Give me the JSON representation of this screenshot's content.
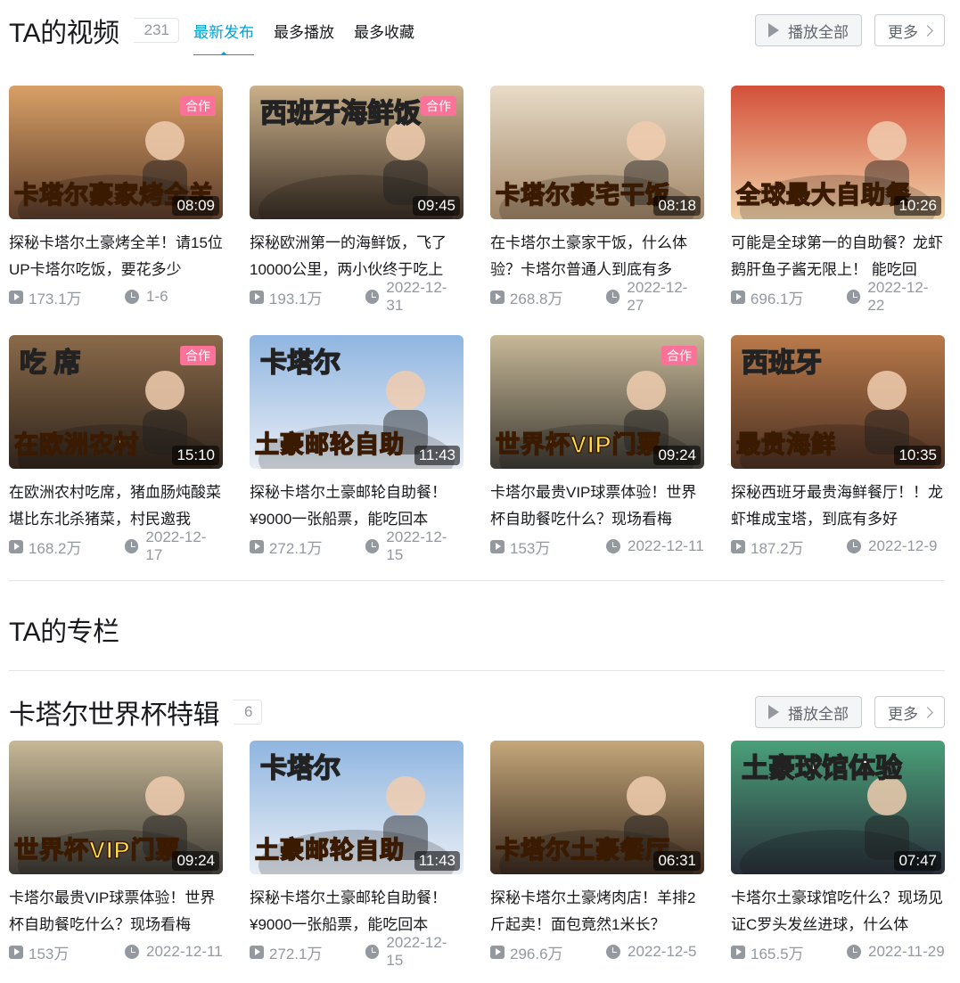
{
  "videos_section": {
    "title": "TA的视频",
    "count": "231",
    "tabs": [
      {
        "label": "最新发布",
        "active": true
      },
      {
        "label": "最多播放",
        "active": false
      },
      {
        "label": "最多收藏",
        "active": false
      }
    ],
    "play_all_label": "播放全部",
    "more_label": "更多",
    "videos": [
      {
        "overlay": "卡塔尔豪家烤全羊",
        "top": "",
        "duration": "08:09",
        "collab": "合作",
        "title": "探秘卡塔尔土豪烤全羊！请15位UP卡塔尔吃饭，要花多少",
        "views": "173.1万",
        "date": "1-6",
        "bg1": "#d9a066",
        "bg2": "#5a3b2a"
      },
      {
        "overlay": "",
        "top": "西班牙海鲜饭",
        "duration": "09:45",
        "collab": "合作",
        "title": "探秘欧洲第一的海鲜饭，飞了10000公里，两小伙终于吃上",
        "views": "193.1万",
        "date": "2022-12-31",
        "bg1": "#c9b08a",
        "bg2": "#3a2e25"
      },
      {
        "overlay": "卡塔尔豪宅干饭",
        "top": "",
        "duration": "08:18",
        "collab": "",
        "title": "在卡塔尔土豪家干饭，什么体验？卡塔尔普通人到底有多",
        "views": "268.8万",
        "date": "2022-12-27",
        "bg1": "#e8dcc8",
        "bg2": "#a08466"
      },
      {
        "overlay": "全球最大自助餐",
        "top": "",
        "duration": "10:26",
        "collab": "",
        "title": "可能是全球第一的自助餐？龙虾鹅肝鱼子酱无限上！ 能吃回",
        "views": "696.1万",
        "date": "2022-12-22",
        "bg1": "#d4503a",
        "bg2": "#f0d2a8"
      },
      {
        "overlay": "在欧洲农村",
        "top": "吃 席",
        "duration": "15:10",
        "collab": "合作",
        "title": "在欧洲农村吃席，猪血肠炖酸菜堪比东北杀猪菜，村民邀我",
        "views": "168.2万",
        "date": "2022-12-17",
        "bg1": "#8a6a4a",
        "bg2": "#2f241c"
      },
      {
        "overlay": "土豪邮轮自助",
        "top": "卡塔尔",
        "duration": "11:43",
        "collab": "",
        "title": "探秘卡塔尔土豪邮轮自助餐！¥9000一张船票，能吃回本",
        "views": "272.1万",
        "date": "2022-12-15",
        "bg1": "#8fb5e0",
        "bg2": "#e9eef5"
      },
      {
        "overlay": "世界杯VIP门票",
        "top": "",
        "duration": "09:24",
        "collab": "合作",
        "title": "卡塔尔最贵VIP球票体验！世界杯自助餐吃什么？现场看梅",
        "views": "153万",
        "date": "2022-12-11",
        "bg1": "#c7b897",
        "bg2": "#3d3a34"
      },
      {
        "overlay": "最贵海鲜",
        "top": "西班牙",
        "duration": "10:35",
        "collab": "",
        "title": "探秘西班牙最贵海鲜餐厅！！龙虾堆成宝塔，到底有多好",
        "views": "187.2万",
        "date": "2022-12-9",
        "bg1": "#b97a4a",
        "bg2": "#4a2f22"
      }
    ]
  },
  "columns_section": {
    "title": "TA的专栏"
  },
  "playlist_section": {
    "title": "卡塔尔世界杯特辑",
    "count": "6",
    "play_all_label": "播放全部",
    "more_label": "更多",
    "videos": [
      {
        "overlay": "世界杯VIP门票",
        "top": "",
        "duration": "09:24",
        "collab": "",
        "title": "卡塔尔最贵VIP球票体验！世界杯自助餐吃什么？现场看梅",
        "views": "153万",
        "date": "2022-12-11",
        "bg1": "#c7b897",
        "bg2": "#3d3a34"
      },
      {
        "overlay": "土豪邮轮自助",
        "top": "卡塔尔",
        "duration": "11:43",
        "collab": "",
        "title": "探秘卡塔尔土豪邮轮自助餐！¥9000一张船票，能吃回本",
        "views": "272.1万",
        "date": "2022-12-15",
        "bg1": "#8fb5e0",
        "bg2": "#e9eef5"
      },
      {
        "overlay": "卡塔尔土豪餐厅",
        "top": "",
        "duration": "06:31",
        "collab": "",
        "title": "探秘卡塔尔土豪烤肉店！羊排2斤起卖！面包竟然1米长？",
        "views": "296.6万",
        "date": "2022-12-5",
        "bg1": "#c4a77a",
        "bg2": "#3a2a1f"
      },
      {
        "overlay": "",
        "top": "土豪球馆体验",
        "duration": "07:47",
        "collab": "",
        "title": "卡塔尔土豪球馆吃什么？现场见证C罗头发丝进球，什么体",
        "views": "165.5万",
        "date": "2022-11-29",
        "bg1": "#4aa07a",
        "bg2": "#2a2f3a"
      }
    ]
  }
}
